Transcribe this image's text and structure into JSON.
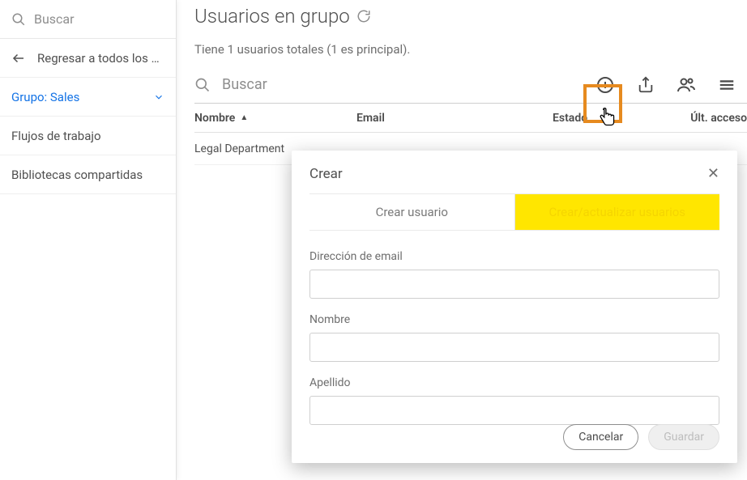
{
  "sidebar": {
    "search_placeholder": "Buscar",
    "back_label": "Regresar a todos los gr...",
    "items": [
      {
        "label": "Grupo: Sales",
        "active": true
      },
      {
        "label": "Flujos de trabajo",
        "active": false
      },
      {
        "label": "Bibliotecas compartidas",
        "active": false
      }
    ]
  },
  "main": {
    "title": "Usuarios en grupo",
    "subtitle": "Tiene 1 usuarios totales (1 es principal).",
    "toolbar_search_placeholder": "Buscar",
    "columns": {
      "name": "Nombre",
      "email": "Email",
      "state": "Estado",
      "last_access": "Últ. acceso"
    },
    "rows": [
      {
        "name": "Legal Department"
      }
    ]
  },
  "modal": {
    "title": "Crear",
    "tabs": {
      "create_user": "Crear usuario",
      "bulk": "Crear/actualizar usuarios"
    },
    "fields": {
      "email_label": "Dirección de email",
      "first_name_label": "Nombre",
      "last_name_label": "Apellido"
    },
    "buttons": {
      "cancel": "Cancelar",
      "save": "Guardar"
    }
  }
}
